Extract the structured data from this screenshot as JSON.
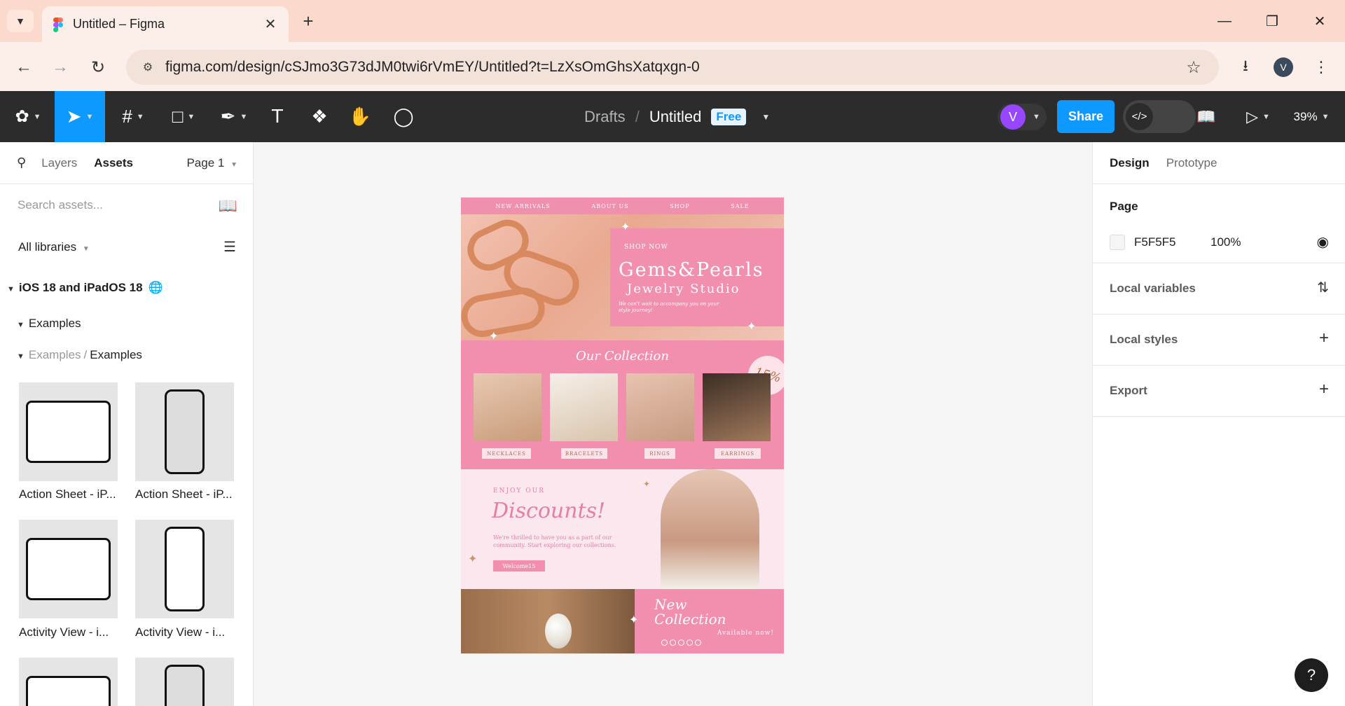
{
  "browser": {
    "tab_title": "Untitled – Figma",
    "url": "figma.com/design/cSJmo3G73dJM0twi6rVmEY/Untitled?t=LzXsOmGhsXatqxgn-0",
    "profile_initial": "V"
  },
  "toolbar": {
    "breadcrumb_drafts": "Drafts",
    "breadcrumb_sep": "/",
    "file_title": "Untitled",
    "plan_badge": "Free",
    "avatar_initial": "V",
    "share_label": "Share",
    "zoom": "39%",
    "text_tool": "T"
  },
  "left_panel": {
    "tabs": [
      "Layers",
      "Assets"
    ],
    "active_tab": "Assets",
    "page_selector": "Page 1",
    "search_placeholder": "Search assets...",
    "libraries_filter": "All libraries",
    "library_name": "iOS 18 and iPadOS 18",
    "group": "Examples",
    "subgroup_parent": "Examples",
    "subgroup_sep": "/",
    "subgroup_name": "Examples",
    "assets": [
      {
        "label": "Action Sheet - iP...",
        "device": "ipad"
      },
      {
        "label": "Action Sheet - iP...",
        "device": "iphone"
      },
      {
        "label": "Activity View - i...",
        "device": "ipad"
      },
      {
        "label": "Activity View - i...",
        "device": "iphone"
      }
    ]
  },
  "right_panel": {
    "tabs": [
      "Design",
      "Prototype"
    ],
    "active_tab": "Design",
    "page_heading": "Page",
    "page_color": "F5F5F5",
    "page_opacity": "100%",
    "sections": [
      "Local variables",
      "Local styles",
      "Export"
    ]
  },
  "help_label": "?",
  "design": {
    "nav": [
      "NEW ARRIVALS",
      "ABOUT US",
      "SHOP",
      "SALE"
    ],
    "shop_now": "SHOP NOW",
    "brand": "Gems&Pearls",
    "studio": "Jewelry Studio",
    "tagline": "We can't wait to accompany you on your style journey!",
    "collection_title": "Our Collection",
    "discount_badge": "15%",
    "products": [
      "NECKLACES",
      "BRACELETS",
      "RINGS",
      "EARRINGS"
    ],
    "enjoy": "ENJOY OUR",
    "discounts_title": "Discounts!",
    "discounts_text": "We're thrilled to have you as a part of our community. Start exploring our collections.",
    "promo_code": "Welcome15",
    "new_title_line1": "New",
    "new_title_line2": "Collection",
    "available": "Available now!"
  },
  "colors": {
    "figma_blue": "#0d99ff",
    "toolbar_bg": "#2c2c2c",
    "design_pink": "#f28fae",
    "design_light_pink": "#fbe8ee",
    "avatar_purple": "#9747ff",
    "chrome_tab_bg": "#fbd9cc"
  }
}
